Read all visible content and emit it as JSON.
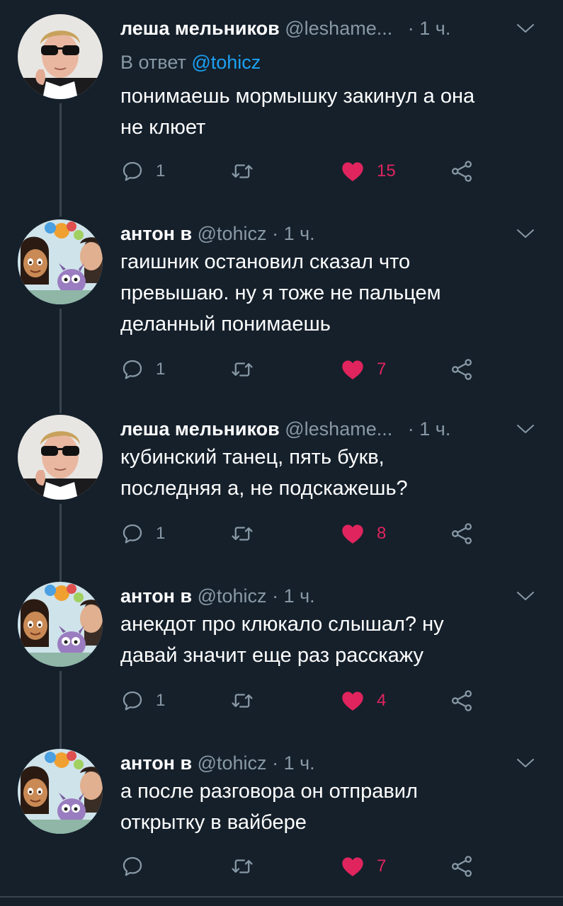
{
  "tweets": [
    {
      "name": "леша мельников",
      "handle": "@leshame...",
      "sep": "·",
      "time": "1 ч.",
      "reply_prefix": "В ответ",
      "reply_to": "@tohicz",
      "text": "понимаешь мормышку закинул а она\nне клюет",
      "replies": "1",
      "likes": "15",
      "avatar": "man-sunglasses"
    },
    {
      "name": "антон в",
      "handle": "@tohicz",
      "sep": "·",
      "time": "1 ч.",
      "text": "гаишник остановил сказал что\nпревышаю. ну я тоже не пальцем\nделанный понимаешь",
      "replies": "1",
      "likes": "7",
      "avatar": "cartoon-selfie"
    },
    {
      "name": "леша мельников",
      "handle": "@leshame...",
      "sep": "·",
      "time": "1 ч.",
      "text": "кубинский танец, пять букв,\nпоследняя а, не подскажешь?",
      "replies": "1",
      "likes": "8",
      "avatar": "man-sunglasses"
    },
    {
      "name": "антон в",
      "handle": "@tohicz",
      "sep": "·",
      "time": "1 ч.",
      "text": "анекдот про клюкало слышал? ну\nдавай значит еще раз расскажу",
      "replies": "1",
      "likes": "4",
      "avatar": "cartoon-selfie"
    },
    {
      "name": "антон в",
      "handle": "@tohicz",
      "sep": "·",
      "time": "1 ч.",
      "text": "а после разговора он отправил\nоткрытку в вайбере",
      "replies": "",
      "likes": "7",
      "avatar": "cartoon-selfie"
    }
  ],
  "colors": {
    "background": "#15202b",
    "secondary_text": "#8899a6",
    "link": "#1da1f2",
    "like": "#e0245e",
    "thread_line": "#38444d"
  },
  "icons": [
    "reply-icon",
    "retweet-icon",
    "like-icon",
    "share-icon",
    "chevron-down-icon"
  ]
}
